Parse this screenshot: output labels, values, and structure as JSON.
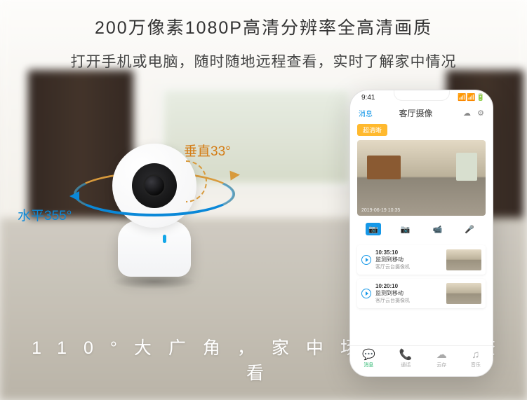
{
  "header": {
    "title": "200万像素1080P高清分辨率全高清画质",
    "subtitle": "打开手机或电脑，随时随地远程查看，实时了解家中情况"
  },
  "camera": {
    "vertical_label": "垂直33°",
    "horizontal_label": "水平355°"
  },
  "phone": {
    "status_time": "9:41",
    "status_right": "📶 📶 🔋",
    "nav_back": "消息",
    "nav_title": "客厅摄像",
    "nav_icon1": "☁",
    "nav_icon2": "⚙",
    "badge": "超清晰",
    "live_info": "2019-06-19 10:35",
    "tools": [
      "📷",
      "📷",
      "📹",
      "🎤"
    ],
    "events": [
      {
        "time": "10:35:10",
        "title": "监测到移动",
        "sub": "客厅云台摄像机"
      },
      {
        "time": "10:20:10",
        "title": "监测到移动",
        "sub": "客厅云台摄像机"
      }
    ],
    "tabs": [
      {
        "icon": "💬",
        "label": "消息"
      },
      {
        "icon": "📞",
        "label": "通话"
      },
      {
        "icon": "☁",
        "label": "云存"
      },
      {
        "icon": "♫",
        "label": "音乐"
      }
    ]
  },
  "footer": "110°大广角，家中场景实时查看"
}
